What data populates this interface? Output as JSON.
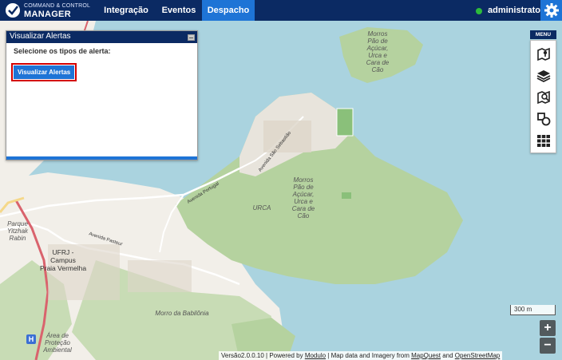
{
  "topbar": {
    "logo_line1": "COMMAND & CONTROL",
    "logo_line2": "MANAGER",
    "tabs": [
      {
        "label": "Integração"
      },
      {
        "label": "Eventos"
      },
      {
        "label": "Despacho",
        "active": true
      }
    ],
    "user": "administrator",
    "status_color": "#2dbb3c",
    "settings_icon": "gear-icon"
  },
  "alert_panel": {
    "title": "Visualizar Alertas",
    "subtitle": "Selecione os tipos de alerta:",
    "button_label": "Visualizar Alertas"
  },
  "menu": {
    "label": "MENU",
    "items": [
      {
        "icon": "map-layer-icon"
      },
      {
        "icon": "layers-icon"
      },
      {
        "icon": "map-search-icon"
      },
      {
        "icon": "shapes-icon"
      },
      {
        "icon": "grid-icon"
      }
    ]
  },
  "map": {
    "labels": {
      "morros_top": "Morros\nPão de\nAçúcar,\nUrca e\nCara de\nCão",
      "morros_center": "Morros\nPão de\nAçúcar,\nUrca e\nCara de\nCão",
      "urca": "URCA",
      "avenida_portugal": "Avenida Portugal",
      "avenida_sao_sebastiao": "Avenida São Sebastião",
      "avenida_pasteur": "Avenida Pasteur",
      "parque": "Parque\nYitzhak\nRabin",
      "ufrj": "UFRJ -\nCampus\nPraia Vermelha",
      "morro_babilonia": "Morro da Babilônia",
      "area_protecao": "Área de\nProteção\nAmbiental"
    },
    "scale": "300 m",
    "zoom_in": "+",
    "zoom_out": "−"
  },
  "attribution": {
    "version": "Versão2.0.0.10 | Powered by ",
    "modulo": "Modulo",
    "mid": " | Map data and Imagery from ",
    "mapquest": "MapQuest",
    "and": " and ",
    "osm": "OpenStreetMap"
  },
  "colors": {
    "topbar": "#0b2a63",
    "accent": "#1e74d6",
    "water": "#aad3df",
    "land": "#f2efe9",
    "park": "#b5d29f",
    "highlight_border": "#d40000"
  }
}
